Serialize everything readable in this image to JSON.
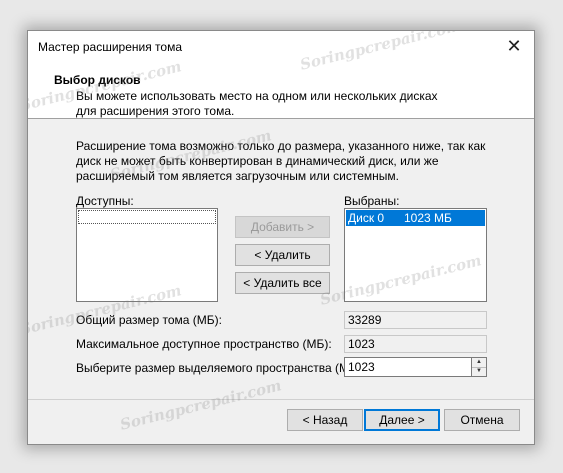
{
  "window": {
    "title": "Мастер расширения тома",
    "close_glyph": "✕"
  },
  "header": {
    "title": "Выбор дисков",
    "subtitle": "Вы можете использовать место на одном или нескольких дисках для расширения этого тома."
  },
  "info_text": "Расширение тома возможно только до размера, указанного ниже, так как диск не может быть конвертирован в динамический диск, или же расширяемый том является загрузочным или системным.",
  "available": {
    "label": "Доступны:",
    "items": []
  },
  "selected": {
    "label": "Выбраны:",
    "items": [
      {
        "disk": "Диск 0",
        "size": "1023 МБ"
      }
    ]
  },
  "buttons": {
    "add": "Добавить >",
    "remove": "< Удалить",
    "remove_all": "< Удалить все",
    "back": "< Назад",
    "next": "Далее >",
    "cancel": "Отмена"
  },
  "fields": {
    "total_size_label": "Общий размер тома (МБ):",
    "total_size_value": "33289",
    "max_available_label": "Максимальное доступное пространство (МБ):",
    "max_available_value": "1023",
    "select_size_label": "Выберите размер выделяемого пространства (МБ):",
    "select_size_value": "1023"
  },
  "watermark": "Soringpcrepair.com",
  "colors": {
    "selection": "#0078d7",
    "dialog_bg": "#f0f0f0",
    "header_bg": "#ffffff"
  }
}
